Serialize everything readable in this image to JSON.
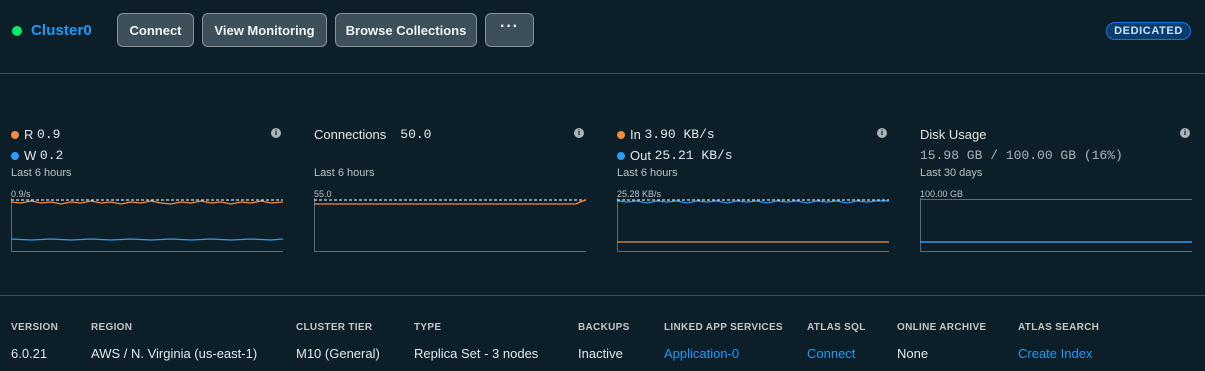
{
  "cluster": {
    "name": "Cluster0",
    "status_color": "#00ed64",
    "tier_badge": "DEDICATED"
  },
  "toolbar": {
    "connect_label": "Connect",
    "view_monitoring_label": "View Monitoring",
    "browse_collections_label": "Browse Collections",
    "more_label": "···"
  },
  "metrics": [
    {
      "series": [
        {
          "name": "R",
          "value": "0.9",
          "color": "#f38c3e"
        },
        {
          "name": "W",
          "value": "0.2",
          "color": "#2e9cf6"
        }
      ],
      "period": "Last 6 hours",
      "max_label": "0.9/s"
    },
    {
      "title": "Connections",
      "value": "50.0",
      "period": "Last 6 hours",
      "max_label": "55.0"
    },
    {
      "series": [
        {
          "name": "In",
          "value": "3.90 KB/s",
          "color": "#f38c3e"
        },
        {
          "name": "Out",
          "value": "25.21 KB/s",
          "color": "#2e9cf6"
        }
      ],
      "period": "Last 6 hours",
      "max_label": "25.28 KB/s"
    },
    {
      "title": "Disk Usage",
      "value": "15.98 GB / 100.00 GB (16%)",
      "used_fraction": 0.16,
      "period": "Last 30 days",
      "max_label": "100.00 GB"
    }
  ],
  "info_icon_glyph": "i",
  "details": [
    {
      "label": "VERSION",
      "value": "6.0.21",
      "link": false
    },
    {
      "label": "REGION",
      "value": "AWS / N. Virginia (us-east-1)",
      "link": false
    },
    {
      "label": "CLUSTER TIER",
      "value": "M10 (General)",
      "link": false
    },
    {
      "label": "TYPE",
      "value": "Replica Set - 3 nodes",
      "link": false
    },
    {
      "label": "BACKUPS",
      "value": "Inactive",
      "link": false
    },
    {
      "label": "LINKED APP SERVICES",
      "value": "Application-0",
      "link": true
    },
    {
      "label": "ATLAS SQL",
      "value": "Connect",
      "link": true
    },
    {
      "label": "ONLINE ARCHIVE",
      "value": "None",
      "link": false
    },
    {
      "label": "ATLAS SEARCH",
      "value": "Create Index",
      "link": true
    }
  ],
  "colors": {
    "accent": "#1a9cf6",
    "background": "#0c1f29",
    "series_orange": "#f38c3e",
    "series_blue": "#2e9cf6"
  }
}
